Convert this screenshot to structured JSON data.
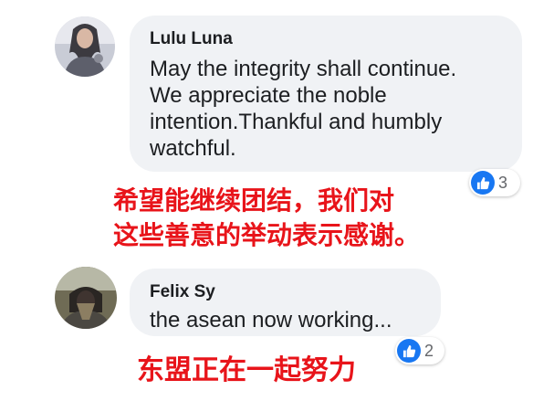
{
  "comments": [
    {
      "author": "Lulu Luna",
      "text": "May the integrity shall continue.\nWe appreciate the noble\nintention.Thankful and humbly\nwatchful.",
      "reactions": "3",
      "caption": "希望能继续团结，我们对\n这些善意的举动表示感谢。"
    },
    {
      "author": "Felix Sy",
      "text": "the asean now working...",
      "reactions": "2",
      "caption": "东盟正在一起努力"
    }
  ],
  "colors": {
    "bubble": "#f0f2f5",
    "like_blue": "#1877f2",
    "caption_red": "#e8141a"
  },
  "icons": {
    "reaction": "like-thumb-icon"
  }
}
